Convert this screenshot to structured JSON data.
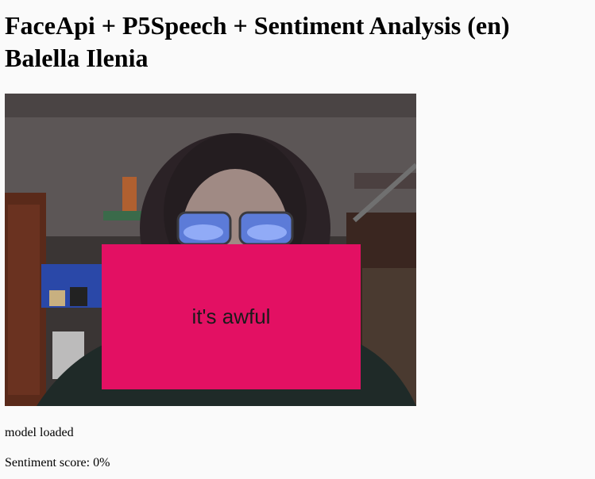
{
  "header": {
    "title_line1": "FaceApi + P5Speech + Sentiment Analysis (en)",
    "title_line2": "Balella Ilenia"
  },
  "camera": {
    "speech_text": "it's awful",
    "overlay_color": "#e31063"
  },
  "status": {
    "model": "model loaded",
    "sentiment_label": "Sentiment score:",
    "sentiment_value": "0%"
  }
}
